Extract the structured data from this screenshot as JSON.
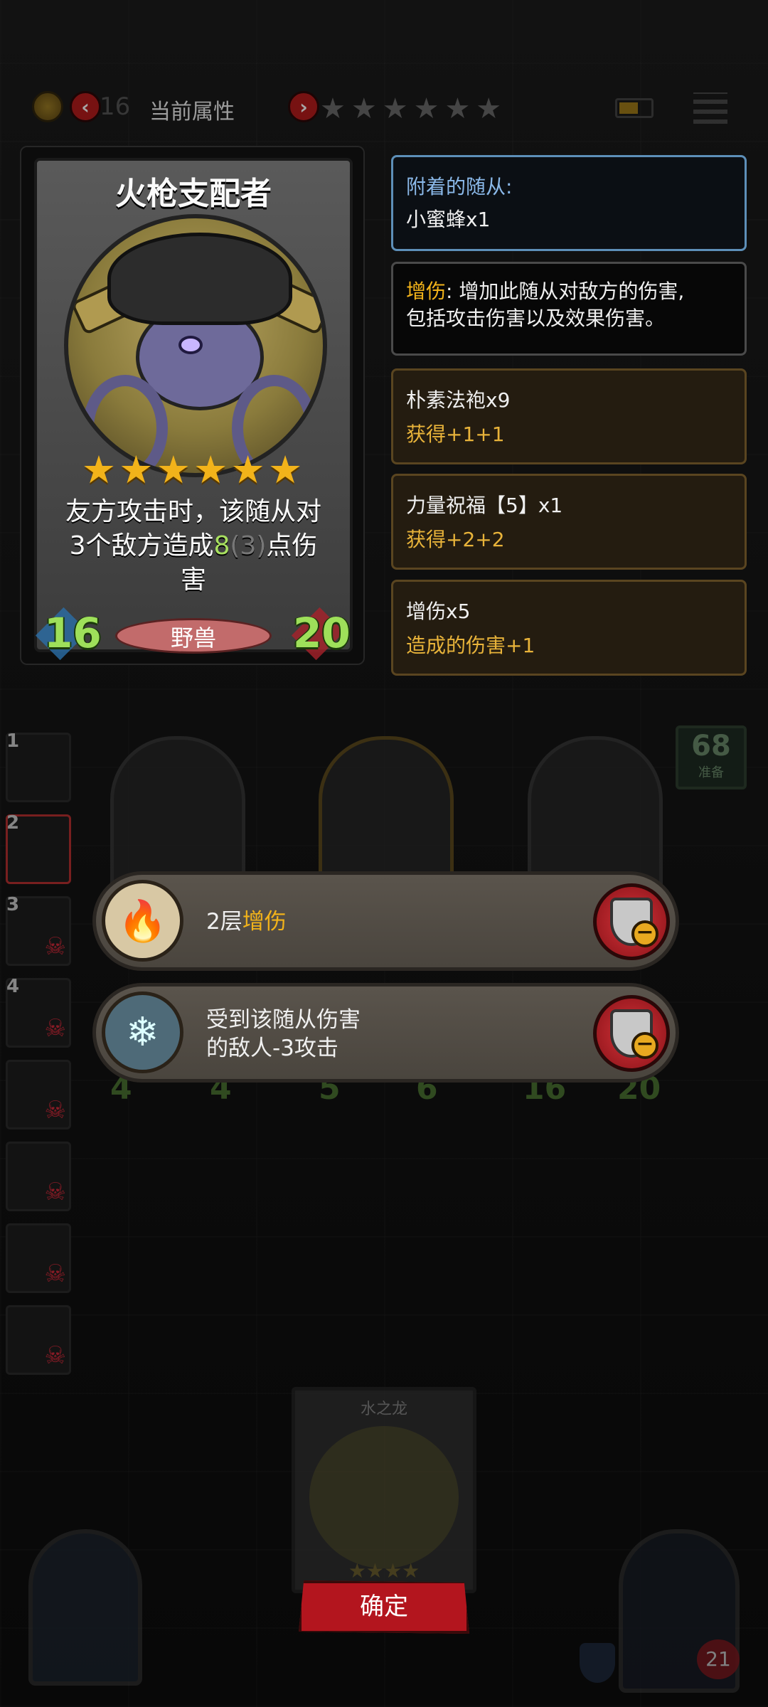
{
  "top_bar": {
    "coin_value": "16",
    "title": "当前属性",
    "stars": "★★★★★★"
  },
  "card": {
    "name": "火枪支配者",
    "stars": "★★★★★★",
    "desc_line1": "友方攻击时，该随从对",
    "desc_line2_a": "3个敌方造成",
    "desc_line2_b": "8",
    "desc_line2_c": "(3)",
    "desc_line2_d": "点伤",
    "desc_line3": "害",
    "attack": "16",
    "health": "20",
    "tribe": "野兽"
  },
  "info": {
    "attached_label": "附着的随从:",
    "attached_value": "小蜜蜂x1",
    "keyword_name": "增伤",
    "keyword_desc_a": ": 增加此随从对敌方的伤害,",
    "keyword_desc_b": "包括攻击伤害以及效果伤害。",
    "equipment": [
      {
        "name": "朴素法袍x9",
        "effect": "获得+1+1"
      },
      {
        "name": "力量祝福【5】x1",
        "effect": "获得+2+2"
      },
      {
        "name": "增伤x5",
        "effect": "造成的伤害+1"
      }
    ]
  },
  "lineup": {
    "slot_numbers": [
      "1",
      "2",
      "3",
      "4"
    ]
  },
  "board": {
    "reserve_count": "68",
    "reserve_label": "准备",
    "minion_stats": [
      {
        "atk": "4",
        "hp": "4"
      },
      {
        "atk": "5",
        "hp": "6"
      },
      {
        "atk": "16",
        "hp": "20"
      }
    ]
  },
  "buffs": [
    {
      "prefix": "2层",
      "keyword": "增伤",
      "line2": ""
    },
    {
      "line1": "受到该随从伤害",
      "line2": "的敌人-3攻击"
    }
  ],
  "bottom": {
    "card_name": "水之龙",
    "card_stars": "★★★★",
    "confirm_label": "确定",
    "hero_hp": "21"
  },
  "colors": {
    "gold": "#f2b31a",
    "green_stat": "#9ee05a",
    "red_button": "#b3151e",
    "attached_border": "#5d8fb8"
  }
}
